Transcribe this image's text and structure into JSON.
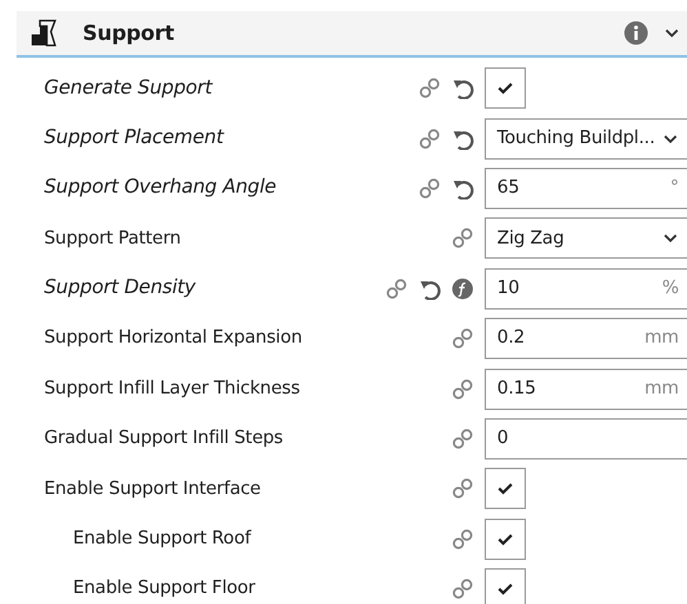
{
  "section": {
    "title": "Support",
    "expanded": true
  },
  "settings": [
    {
      "label": "Generate Support",
      "modified": true,
      "linked": true,
      "resettable": true,
      "function": false,
      "kind": "checkbox",
      "checked": true
    },
    {
      "label": "Support Placement",
      "modified": true,
      "linked": true,
      "resettable": true,
      "function": false,
      "kind": "select",
      "value": "Touching Buildpl..."
    },
    {
      "label": "Support Overhang Angle",
      "modified": true,
      "linked": true,
      "resettable": true,
      "function": false,
      "kind": "number",
      "value": "65",
      "unit": "°"
    },
    {
      "label": "Support Pattern",
      "modified": false,
      "linked": true,
      "resettable": false,
      "function": false,
      "kind": "select",
      "value": "Zig Zag"
    },
    {
      "label": "Support Density",
      "modified": true,
      "linked": true,
      "resettable": true,
      "function": true,
      "kind": "number",
      "value": "10",
      "unit": "%"
    },
    {
      "label": "Support Horizontal Expansion",
      "modified": false,
      "linked": true,
      "resettable": false,
      "function": false,
      "kind": "number",
      "value": "0.2",
      "unit": "mm"
    },
    {
      "label": "Support Infill Layer Thickness",
      "modified": false,
      "linked": true,
      "resettable": false,
      "function": false,
      "kind": "number",
      "value": "0.15",
      "unit": "mm"
    },
    {
      "label": "Gradual Support Infill Steps",
      "modified": false,
      "linked": true,
      "resettable": false,
      "function": false,
      "kind": "number",
      "value": "0"
    },
    {
      "label": "Enable Support Interface",
      "modified": false,
      "linked": true,
      "resettable": false,
      "function": false,
      "kind": "checkbox",
      "checked": true,
      "children": [
        {
          "label": "Enable Support Roof",
          "modified": false,
          "linked": true,
          "resettable": false,
          "function": false,
          "kind": "checkbox",
          "checked": true
        },
        {
          "label": "Enable Support Floor",
          "modified": false,
          "linked": true,
          "resettable": false,
          "function": false,
          "kind": "checkbox",
          "checked": true
        }
      ]
    }
  ]
}
